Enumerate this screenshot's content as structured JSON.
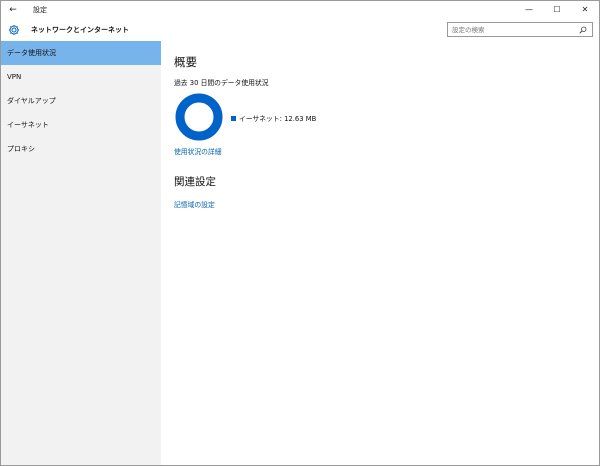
{
  "window": {
    "title": "設定",
    "controls": {
      "minimize": "—",
      "maximize": "☐",
      "close": "✕"
    },
    "back_glyph": "←"
  },
  "header": {
    "title": "ネットワークとインターネット",
    "icon": "gear-icon",
    "search": {
      "placeholder": "設定の検索",
      "value": ""
    }
  },
  "sidebar": {
    "items": [
      {
        "label": "データ使用状況",
        "active": true
      },
      {
        "label": "VPN",
        "active": false
      },
      {
        "label": "ダイヤルアップ",
        "active": false
      },
      {
        "label": "イーサネット",
        "active": false
      },
      {
        "label": "プロキシ",
        "active": false
      }
    ]
  },
  "main": {
    "overview_title": "概要",
    "period_text": "過去 30 日間のデータ使用状況",
    "usage": {
      "legend_label": "イーサネット: 12.63 MB",
      "fraction": 1.0,
      "color": "#0063c9"
    },
    "details_link": "使用状況の詳細",
    "related_title": "関連設定",
    "storage_link": "記憶域の設定"
  },
  "colors": {
    "accent": "#0063c9",
    "link": "#0063b1",
    "sidebar_bg": "#f2f2f2",
    "selected_bg": "#78b4ec"
  }
}
